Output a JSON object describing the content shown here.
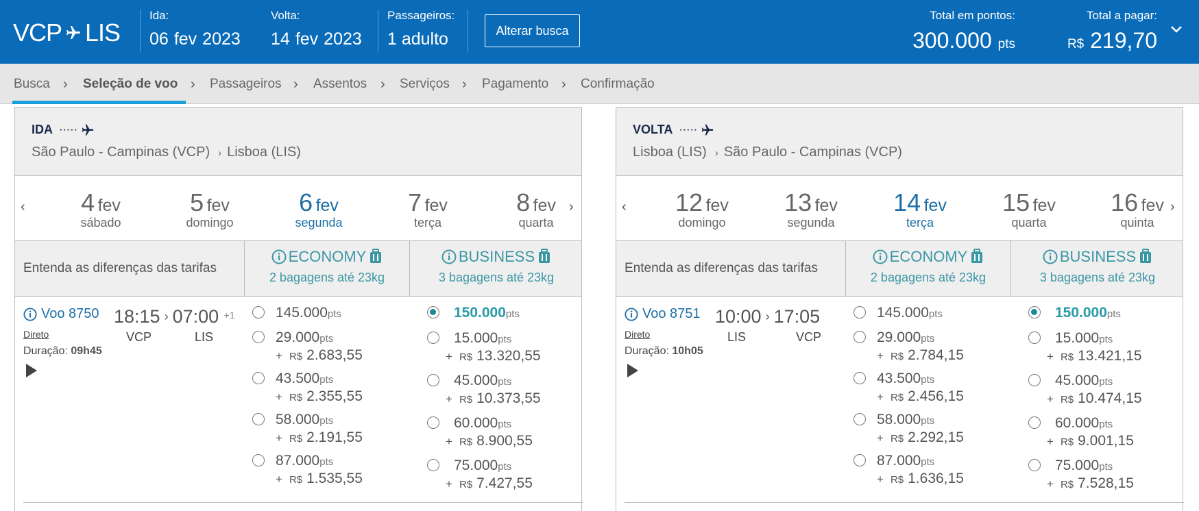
{
  "header": {
    "logo": {
      "from": "VCP",
      "to": "LIS"
    },
    "ida": {
      "label": "Ida:",
      "day": "06",
      "month": "fev",
      "year": "2023"
    },
    "volta": {
      "label": "Volta:",
      "day": "14",
      "month": "fev",
      "year": "2023"
    },
    "passageiros": {
      "label": "Passageiros:",
      "value": "1 adulto"
    },
    "alter_button": "Alterar busca",
    "total_points": {
      "label": "Total em pontos:",
      "value": "300.000",
      "unit": "pts"
    },
    "total_pay": {
      "label": "Total a pagar:",
      "currency": "R$",
      "value": "219,70"
    }
  },
  "breadcrumb": [
    {
      "label": "Busca"
    },
    {
      "label": "Seleção de voo",
      "current": true
    },
    {
      "label": "Passageiros"
    },
    {
      "label": "Assentos"
    },
    {
      "label": "Serviços"
    },
    {
      "label": "Pagamento"
    },
    {
      "label": "Confirmação"
    }
  ],
  "panels": [
    {
      "direction": "IDA",
      "origin": "São Paulo - Campinas (VCP)",
      "destination": "Lisboa (LIS)",
      "dates": [
        {
          "day": "4",
          "month": "fev",
          "weekday": "sábado"
        },
        {
          "day": "5",
          "month": "fev",
          "weekday": "domingo"
        },
        {
          "day": "6",
          "month": "fev",
          "weekday": "segunda",
          "selected": true
        },
        {
          "day": "7",
          "month": "fev",
          "weekday": "terça"
        },
        {
          "day": "8",
          "month": "fev",
          "weekday": "quarta"
        }
      ],
      "fare_info": "Entenda as diferenças das tarifas",
      "economy": {
        "name": "ECONOMY",
        "bags": "2 bagagens até 23kg"
      },
      "business": {
        "name": "BUSINESS",
        "bags": "3 bagagens até 23kg"
      },
      "flight": {
        "number": "Voo 8750",
        "direct": "Direto",
        "duration_label": "Duração:",
        "duration": "09h45",
        "dep_time": "18:15",
        "arr_time": "07:00",
        "plus_day": "+1",
        "dep_airport": "VCP",
        "arr_airport": "LIS"
      },
      "economy_options": [
        {
          "points": "145.000",
          "unit": "pts",
          "money": ""
        },
        {
          "points": "29.000",
          "unit": "pts",
          "money": "2.683,55"
        },
        {
          "points": "43.500",
          "unit": "pts",
          "money": "2.355,55"
        },
        {
          "points": "58.000",
          "unit": "pts",
          "money": "2.191,55"
        },
        {
          "points": "87.000",
          "unit": "pts",
          "money": "1.535,55"
        }
      ],
      "business_options": [
        {
          "points": "150.000",
          "unit": "pts",
          "money": "",
          "selected": true
        },
        {
          "points": "15.000",
          "unit": "pts",
          "money": "13.320,55"
        },
        {
          "points": "45.000",
          "unit": "pts",
          "money": "10.373,55"
        },
        {
          "points": "60.000",
          "unit": "pts",
          "money": "8.900,55"
        },
        {
          "points": "75.000",
          "unit": "pts",
          "money": "7.427,55"
        }
      ]
    },
    {
      "direction": "VOLTA",
      "origin": "Lisboa (LIS)",
      "destination": "São Paulo - Campinas (VCP)",
      "dates": [
        {
          "day": "12",
          "month": "fev",
          "weekday": "domingo"
        },
        {
          "day": "13",
          "month": "fev",
          "weekday": "segunda"
        },
        {
          "day": "14",
          "month": "fev",
          "weekday": "terça",
          "selected": true
        },
        {
          "day": "15",
          "month": "fev",
          "weekday": "quarta"
        },
        {
          "day": "16",
          "month": "fev",
          "weekday": "quinta"
        }
      ],
      "fare_info": "Entenda as diferenças das tarifas",
      "economy": {
        "name": "ECONOMY",
        "bags": "2 bagagens até 23kg"
      },
      "business": {
        "name": "BUSINESS",
        "bags": "3 bagagens até 23kg"
      },
      "flight": {
        "number": "Voo 8751",
        "direct": "Direto",
        "duration_label": "Duração:",
        "duration": "10h05",
        "dep_time": "10:00",
        "arr_time": "17:05",
        "plus_day": "",
        "dep_airport": "LIS",
        "arr_airport": "VCP"
      },
      "economy_options": [
        {
          "points": "145.000",
          "unit": "pts",
          "money": ""
        },
        {
          "points": "29.000",
          "unit": "pts",
          "money": "2.784,15"
        },
        {
          "points": "43.500",
          "unit": "pts",
          "money": "2.456,15"
        },
        {
          "points": "58.000",
          "unit": "pts",
          "money": "2.292,15"
        },
        {
          "points": "87.000",
          "unit": "pts",
          "money": "1.636,15"
        }
      ],
      "business_options": [
        {
          "points": "150.000",
          "unit": "pts",
          "money": "",
          "selected": true
        },
        {
          "points": "15.000",
          "unit": "pts",
          "money": "13.421,15"
        },
        {
          "points": "45.000",
          "unit": "pts",
          "money": "10.474,15"
        },
        {
          "points": "60.000",
          "unit": "pts",
          "money": "9.001,15"
        },
        {
          "points": "75.000",
          "unit": "pts",
          "money": "7.528,15"
        }
      ]
    }
  ],
  "colors": {
    "header_bg": "#0a6bb8",
    "accent_teal": "#2a9aa8",
    "selected_date": "#1e6fa6",
    "tab_underline": "#1b9fd8"
  },
  "icons": [
    "plane-icon",
    "chevron-right-icon",
    "chevron-down-icon",
    "chevron-left-icon",
    "info-icon",
    "luggage-icon",
    "play-icon",
    "radio-button"
  ]
}
